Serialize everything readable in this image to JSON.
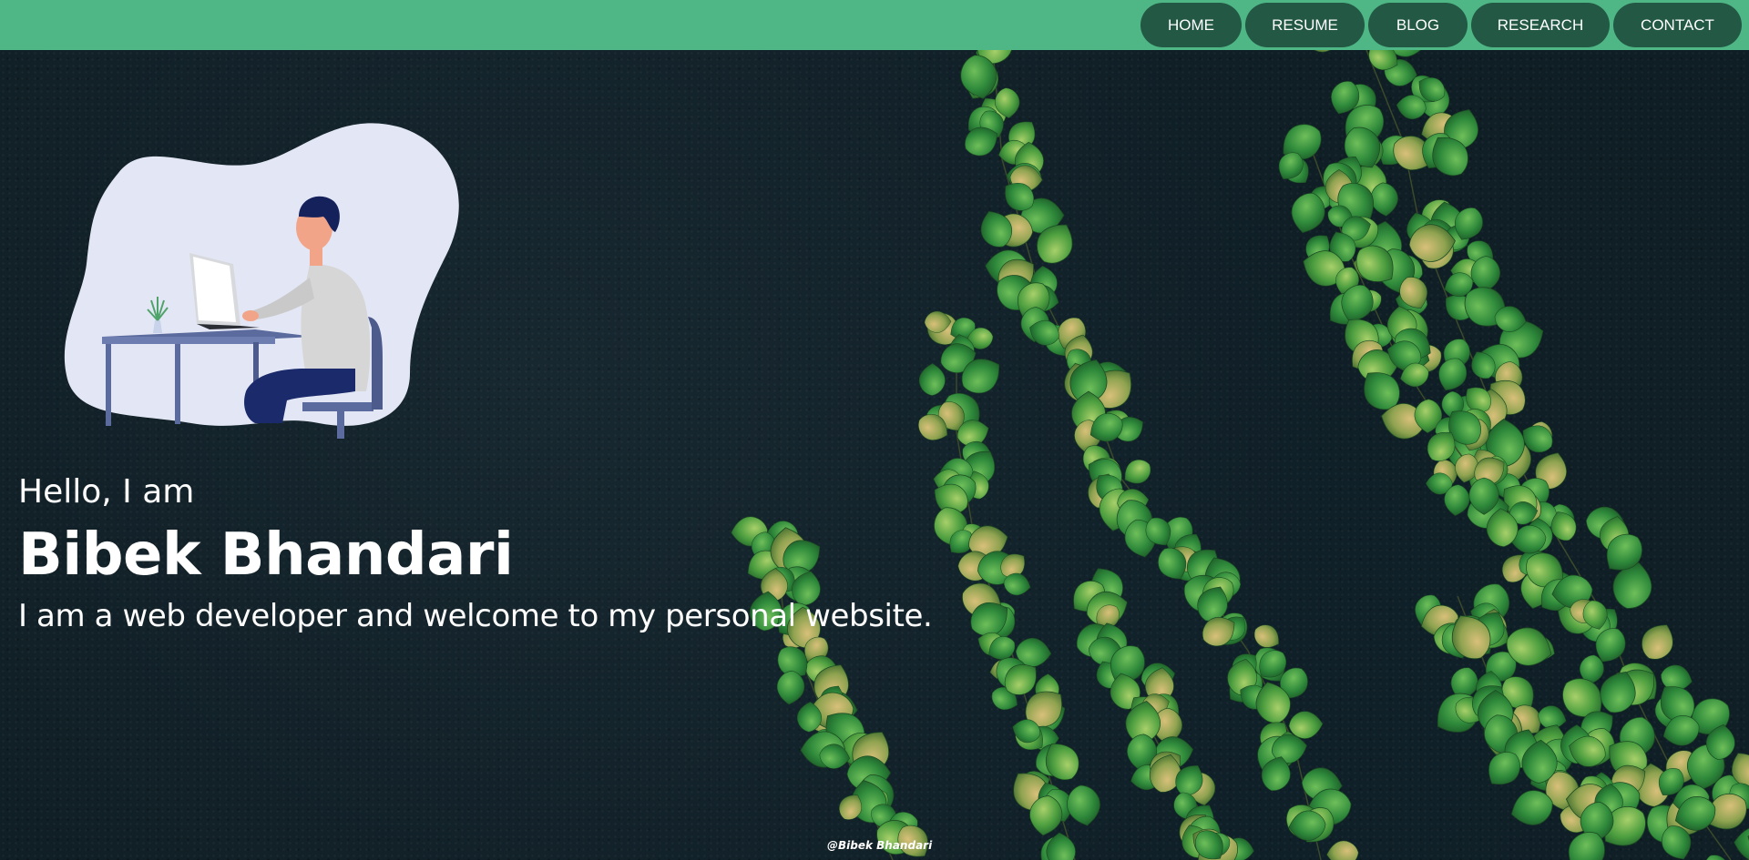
{
  "nav": {
    "items": [
      {
        "label": "HOME"
      },
      {
        "label": "RESUME"
      },
      {
        "label": "BLOG"
      },
      {
        "label": "RESEARCH"
      },
      {
        "label": "CONTACT"
      }
    ]
  },
  "hero": {
    "greeting": "Hello, I am",
    "name": "Bibek Bhandari",
    "tagline": "I am a web developer and welcome to my personal website."
  },
  "footer": {
    "credit": "@Bibek Bhandari"
  },
  "colors": {
    "header_bg": "#4fb785",
    "nav_button_bg": "#225844",
    "hero_bg": "#0f1d24",
    "blob_bg": "#e3e7f5"
  },
  "icons": {
    "illustration": "person-at-desk-illustration"
  }
}
